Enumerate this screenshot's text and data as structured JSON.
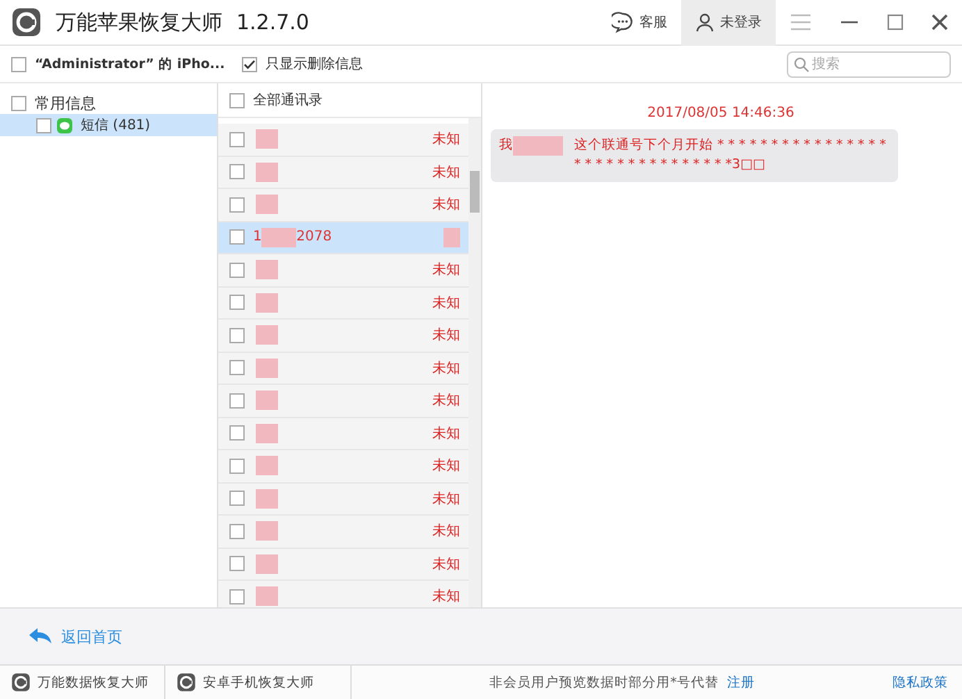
{
  "window": {
    "title": "万能苹果恢复大师",
    "version": "1.2.7.0",
    "service": "客服",
    "account": "未登录"
  },
  "toolbar": {
    "device": {
      "label": "“Administrator” 的 iPho...",
      "checked": false
    },
    "deleted_only": {
      "label": "只显示删除信息",
      "checked": true
    },
    "search": {
      "placeholder": "搜索"
    }
  },
  "sidebar": {
    "items": [
      {
        "label": "常用信息",
        "checked": false,
        "selected": false,
        "children": [
          {
            "label": "短信 (481)",
            "checked": false,
            "selected": true
          }
        ]
      }
    ]
  },
  "contacts": {
    "header": {
      "label": "全部通讯录",
      "checked": false
    },
    "rows": [
      {
        "status": "未知",
        "selected": false,
        "checked": false
      },
      {
        "status": "未知",
        "selected": false,
        "checked": false
      },
      {
        "status": "未知",
        "selected": false,
        "checked": false
      },
      {
        "name_start": "1",
        "name_end": "2078",
        "selected": true,
        "checked": false
      },
      {
        "status": "未知",
        "selected": false,
        "checked": false
      },
      {
        "status": "未知",
        "selected": false,
        "checked": false
      },
      {
        "status": "未知",
        "selected": false,
        "checked": false
      },
      {
        "status": "未知",
        "selected": false,
        "checked": false
      },
      {
        "status": "未知",
        "selected": false,
        "checked": false
      },
      {
        "status": "未知",
        "selected": false,
        "checked": false
      },
      {
        "status": "未知",
        "selected": false,
        "checked": false
      },
      {
        "status": "未知",
        "selected": false,
        "checked": false
      },
      {
        "status": "未知",
        "selected": false,
        "checked": false
      },
      {
        "status": "未知",
        "selected": false,
        "checked": false
      },
      {
        "status": "未知",
        "selected": false,
        "checked": false
      }
    ]
  },
  "conversation": {
    "timestamp": "2017/08/05 14:46:36",
    "messages": [
      {
        "start": "我",
        "text": "这个联通号下个月开始 * * * * * * * * * * * * * * * * * * * * * * * * * * * * * * *3□□"
      }
    ]
  },
  "footer": {
    "back": "返回首页"
  },
  "status_bar": {
    "apps": [
      "万能数据恢复大师",
      "安卓手机恢复大师"
    ],
    "notice": "非会员用户预览数据时部分用*号代替",
    "register": "注册",
    "privacy": "隐私政策"
  }
}
